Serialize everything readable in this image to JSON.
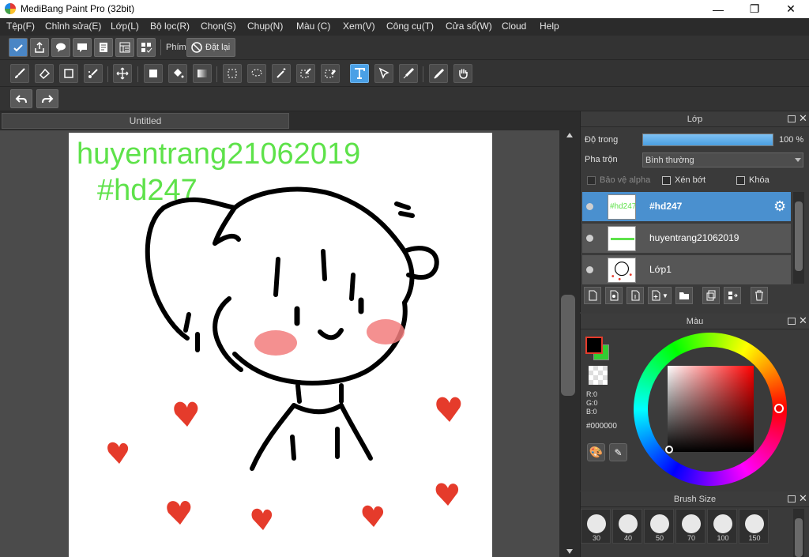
{
  "app": {
    "title": "MediBang Paint Pro (32bit)"
  },
  "window_controls": {
    "minimize": "—",
    "maximize": "❐",
    "close": "✕"
  },
  "menu": [
    "Tệp(F)",
    "Chỉnh sửa(E)",
    "Lớp(L)",
    "Bộ lọc(R)",
    "Chọn(S)",
    "Chụp(N)",
    "Màu (C)",
    "Xem(V)",
    "Công cụ(T)",
    "Cửa sổ(W)",
    "Cloud",
    "Help"
  ],
  "toolbar1": {
    "shortcut_label": "Phím",
    "reset_label": "Đặt lại"
  },
  "tab": {
    "title": "Untitled"
  },
  "canvas": {
    "text_line1": "huyentrang21062019",
    "text_line2": "#hd247",
    "text_color": "#5ee24a"
  },
  "layer_panel": {
    "title": "Lớp",
    "opacity_label": "Độ trong",
    "opacity_value": "100 %",
    "opacity_percent": 100,
    "blend_label": "Pha trộn",
    "blend_value": "Bình thường",
    "protect_alpha": "Bảo vệ alpha",
    "clipping": "Xén bớt",
    "lock": "Khóa",
    "layers": [
      {
        "name": "#hd247",
        "thumb": "#hd247",
        "selected": true
      },
      {
        "name": "huyentrang21062019",
        "selected": false
      },
      {
        "name": "Lớp1",
        "selected": false
      }
    ]
  },
  "color_panel": {
    "title": "Màu",
    "r": "R:0",
    "g": "G:0",
    "b": "B:0",
    "hex": "#000000",
    "primary_color": "#000000",
    "secondary_color": "#33cc33"
  },
  "brush_panel": {
    "title": "Brush Size",
    "sizes": [
      "30",
      "40",
      "50",
      "70",
      "100",
      "150"
    ]
  },
  "colors": {
    "accent": "#4a90cf",
    "heart": "#e53b2b",
    "blush": "#f08080"
  }
}
